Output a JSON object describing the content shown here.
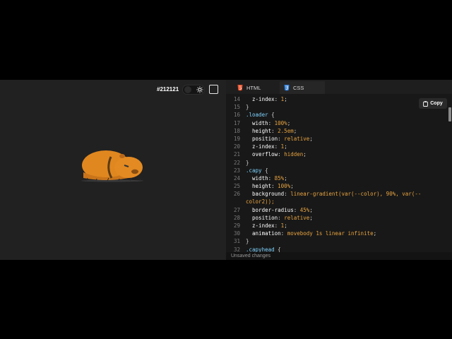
{
  "preview": {
    "bg_color_label": "#212121",
    "bg_color": "#212121",
    "capybara_colors": {
      "body": "#e0871f",
      "shadow": "#b8681a",
      "eye": "#333333"
    }
  },
  "tabs": [
    {
      "label": "HTML",
      "icon": "html5-icon",
      "color": "#e44d26"
    },
    {
      "label": "CSS",
      "icon": "css3-icon",
      "color": "#2f7fd8"
    }
  ],
  "copy_label": "Copy",
  "status_text": "Unsaved changes",
  "code_lines": [
    {
      "n": "14",
      "parts": [
        [
          "p",
          "  z-index"
        ],
        [
          "t",
          ": "
        ],
        [
          "v",
          "1"
        ],
        [
          "t",
          ";"
        ]
      ]
    },
    {
      "n": "15",
      "parts": [
        [
          "t",
          "}"
        ]
      ]
    },
    {
      "n": "16",
      "parts": [
        [
          "s",
          ".loader"
        ],
        [
          "t",
          " {"
        ]
      ]
    },
    {
      "n": "17",
      "parts": [
        [
          "p",
          "  width"
        ],
        [
          "t",
          ": "
        ],
        [
          "v",
          "100%"
        ],
        [
          "t",
          ";"
        ]
      ]
    },
    {
      "n": "18",
      "parts": [
        [
          "p",
          "  height"
        ],
        [
          "t",
          ": "
        ],
        [
          "v",
          "2.5em"
        ],
        [
          "t",
          ";"
        ]
      ]
    },
    {
      "n": "19",
      "parts": [
        [
          "p",
          "  position"
        ],
        [
          "t",
          ": "
        ],
        [
          "v",
          "relative"
        ],
        [
          "t",
          ";"
        ]
      ]
    },
    {
      "n": "20",
      "parts": [
        [
          "p",
          "  z-index"
        ],
        [
          "t",
          ": "
        ],
        [
          "v",
          "1"
        ],
        [
          "t",
          ";"
        ]
      ]
    },
    {
      "n": "21",
      "parts": [
        [
          "p",
          "  overflow"
        ],
        [
          "t",
          ": "
        ],
        [
          "v",
          "hidden"
        ],
        [
          "t",
          ";"
        ]
      ]
    },
    {
      "n": "22",
      "parts": [
        [
          "t",
          "}"
        ]
      ]
    },
    {
      "n": "23",
      "parts": [
        [
          "s",
          ".capy"
        ],
        [
          "t",
          " {"
        ]
      ]
    },
    {
      "n": "24",
      "parts": [
        [
          "p",
          "  width"
        ],
        [
          "t",
          ": "
        ],
        [
          "v",
          "85%"
        ],
        [
          "t",
          ";"
        ]
      ]
    },
    {
      "n": "25",
      "parts": [
        [
          "p",
          "  height"
        ],
        [
          "t",
          ": "
        ],
        [
          "v",
          "100%"
        ],
        [
          "t",
          ";"
        ]
      ]
    },
    {
      "n": "26",
      "parts": [
        [
          "p",
          "  background"
        ],
        [
          "t",
          ": "
        ],
        [
          "v",
          "linear-gradient(var(--color), 90%, var(--"
        ]
      ]
    },
    {
      "n": "",
      "parts": [
        [
          "v",
          "color2));"
        ]
      ]
    },
    {
      "n": "27",
      "parts": [
        [
          "p",
          "  border-radius"
        ],
        [
          "t",
          ": "
        ],
        [
          "v",
          "45%"
        ],
        [
          "t",
          ";"
        ]
      ]
    },
    {
      "n": "28",
      "parts": [
        [
          "p",
          "  position"
        ],
        [
          "t",
          ": "
        ],
        [
          "v",
          "relative"
        ],
        [
          "t",
          ";"
        ]
      ]
    },
    {
      "n": "29",
      "parts": [
        [
          "p",
          "  z-index"
        ],
        [
          "t",
          ": "
        ],
        [
          "v",
          "1"
        ],
        [
          "t",
          ";"
        ]
      ]
    },
    {
      "n": "30",
      "parts": [
        [
          "p",
          "  animation"
        ],
        [
          "t",
          ": "
        ],
        [
          "v",
          "movebody 1s linear infinite"
        ],
        [
          "t",
          ";"
        ]
      ]
    },
    {
      "n": "31",
      "parts": [
        [
          "t",
          "}"
        ]
      ]
    },
    {
      "n": "32",
      "parts": [
        [
          "s",
          ".capyhead"
        ],
        [
          "t",
          " {"
        ]
      ]
    }
  ]
}
